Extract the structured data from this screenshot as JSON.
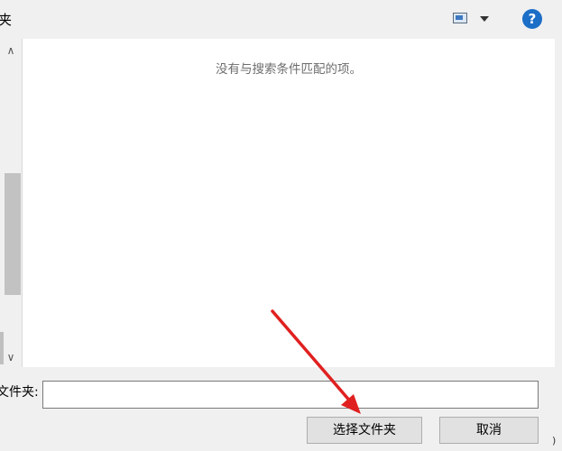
{
  "toolbar": {
    "title_fragment": "夹",
    "view_icon": "change-view-icon",
    "dropdown_icon": "chevron-down-icon",
    "help_icon": "help-icon",
    "help_glyph": "?"
  },
  "nav": {
    "scroll_up_glyph": "∧",
    "scroll_down_glyph": "∨"
  },
  "content": {
    "empty_message": "没有与搜索条件匹配的项。"
  },
  "footer": {
    "folder_label": "文件夹:",
    "folder_value": "",
    "select_button": "选择文件夹",
    "cancel_button": "取消",
    "corner_text": ")"
  },
  "annotation": {
    "arrow_color": "#e02020"
  }
}
